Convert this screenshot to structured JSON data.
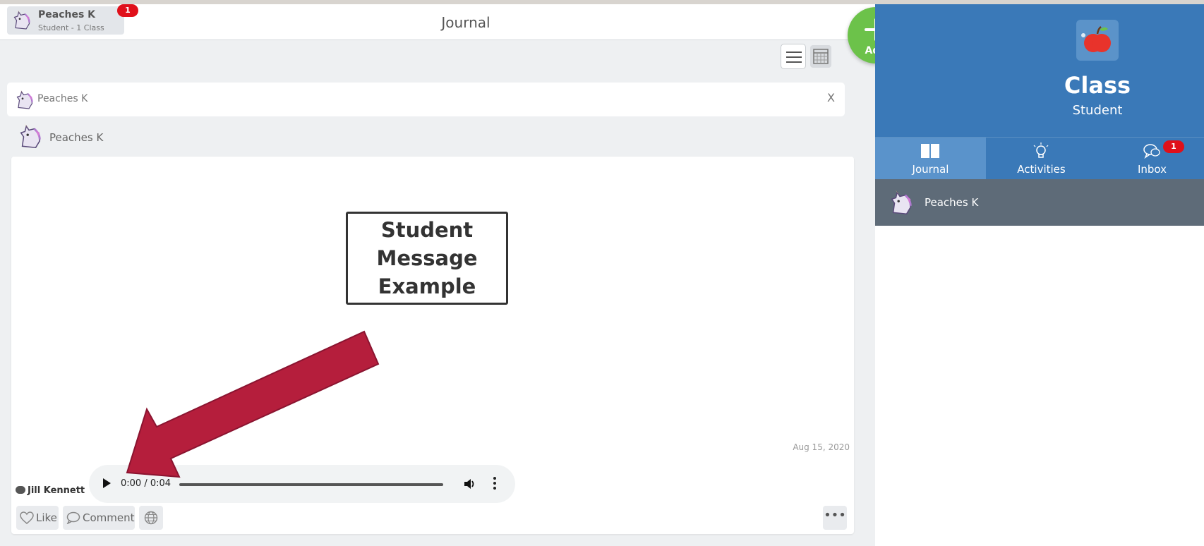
{
  "header": {
    "user_name": "Peaches K",
    "user_sub": "Student - 1 Class",
    "notification_count": "1",
    "title": "Journal"
  },
  "filter": {
    "name": "Peaches K",
    "clear_label": "X"
  },
  "post": {
    "author_name": "Peaches K",
    "message_lines": [
      "Student",
      "Message",
      "Example"
    ],
    "date": "Aug 15, 2020",
    "commenter": "Jill Kennett",
    "audio_time": "0:00 / 0:04",
    "like_label": "Like",
    "comment_label": "Comment",
    "more_label": "•••"
  },
  "add_button": {
    "label": "Add"
  },
  "class_panel": {
    "name": "Class",
    "role": "Student",
    "tabs": [
      {
        "label": "Journal",
        "icon": "book-icon"
      },
      {
        "label": "Activities",
        "icon": "lightbulb-icon"
      },
      {
        "label": "Inbox",
        "icon": "chat-icon",
        "badge": "1"
      }
    ],
    "students": [
      {
        "name": "Peaches K"
      }
    ]
  },
  "colors": {
    "class_blue": "#3a79b8",
    "add_green": "#6cc24a",
    "badge_red": "#e0101a",
    "arrow_red": "#b51e3c"
  }
}
